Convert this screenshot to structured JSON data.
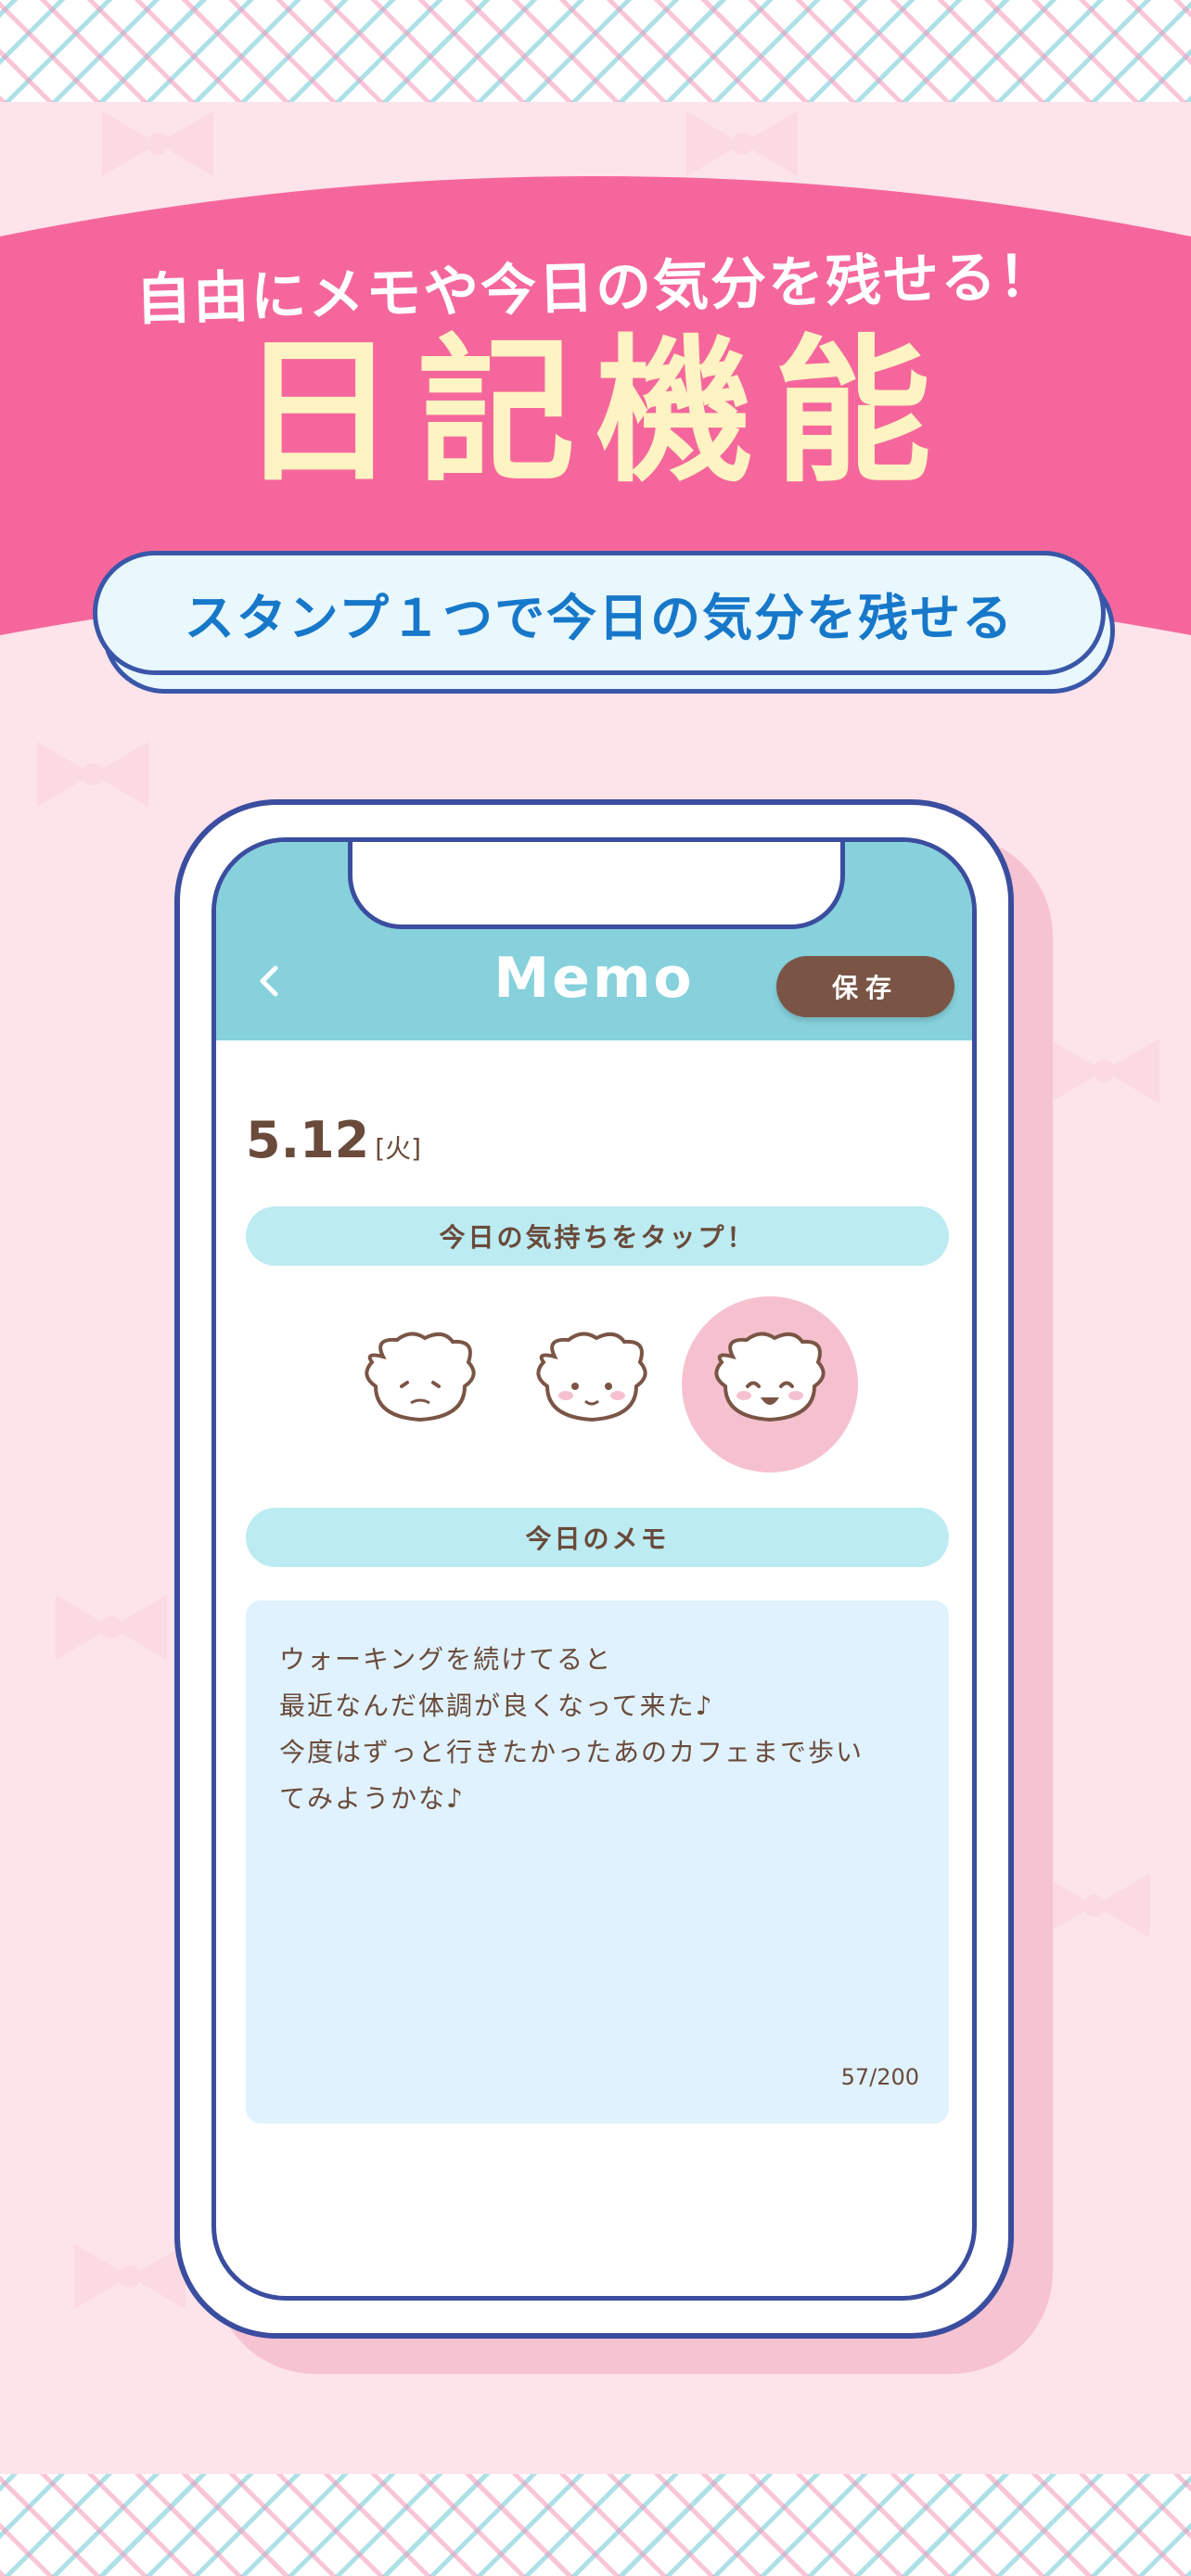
{
  "banner": {
    "subtitle": "自由にメモや今日の気分を残せる！",
    "title": "日記機能",
    "pill": "スタンプ１つで今日の気分を残せる"
  },
  "colors": {
    "banner_pink": "#f5679c",
    "title_cream": "#fef3c2",
    "pill_text_blue": "#1778c9",
    "header_teal": "#86d1dc",
    "save_brown": "#7a5546",
    "text_brown": "#6a4a3a",
    "section_bar": "#bcebf2",
    "memo_bg": "#dff2fd",
    "selected_mood": "#f6c1cf"
  },
  "app": {
    "title": "Memo",
    "back_icon": "chevron-left-icon",
    "save_label": "保存",
    "date": {
      "day": "5.12",
      "weekday": "[火]"
    },
    "mood_section_label": "今日の気持ちをタップ！",
    "moods": [
      {
        "icon": "sad-dog-icon",
        "selected": false
      },
      {
        "icon": "neutral-dog-icon",
        "selected": false
      },
      {
        "icon": "happy-dog-icon",
        "selected": true
      }
    ],
    "memo_section_label": "今日のメモ",
    "memo_lines": [
      "ウォーキングを続けてると",
      "最近なんだ体調が良くなって来た♪",
      "今度はずっと行きたかったあのカフェまで歩い",
      "てみようかな♪"
    ],
    "char_count": "57/200"
  }
}
